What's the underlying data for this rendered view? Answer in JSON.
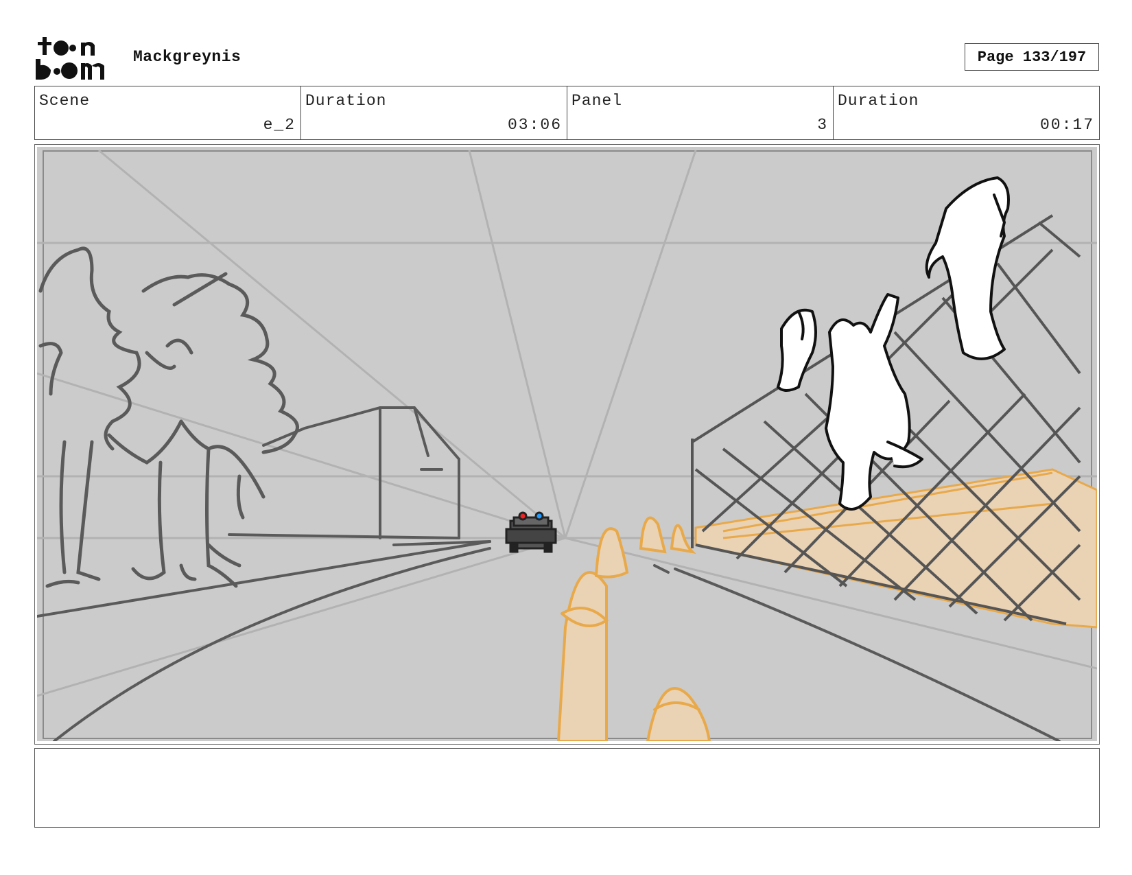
{
  "header": {
    "logo_icon": "toon-boom-logo",
    "project_name": "Mackgreynis",
    "page_label": "Page 133/197"
  },
  "info": {
    "scene_label": "Scene",
    "scene_value": "e_2",
    "scene_duration_label": "Duration",
    "scene_duration_value": "03:06",
    "panel_label": "Panel",
    "panel_value": "3",
    "panel_duration_label": "Duration",
    "panel_duration_value": "00:17"
  },
  "panel": {
    "background_color": "#cbcbcb",
    "line_color": "#555555",
    "cone_color": "#e8a94a",
    "cone_fill": "#ead2b4"
  },
  "notes": {
    "text": ""
  }
}
